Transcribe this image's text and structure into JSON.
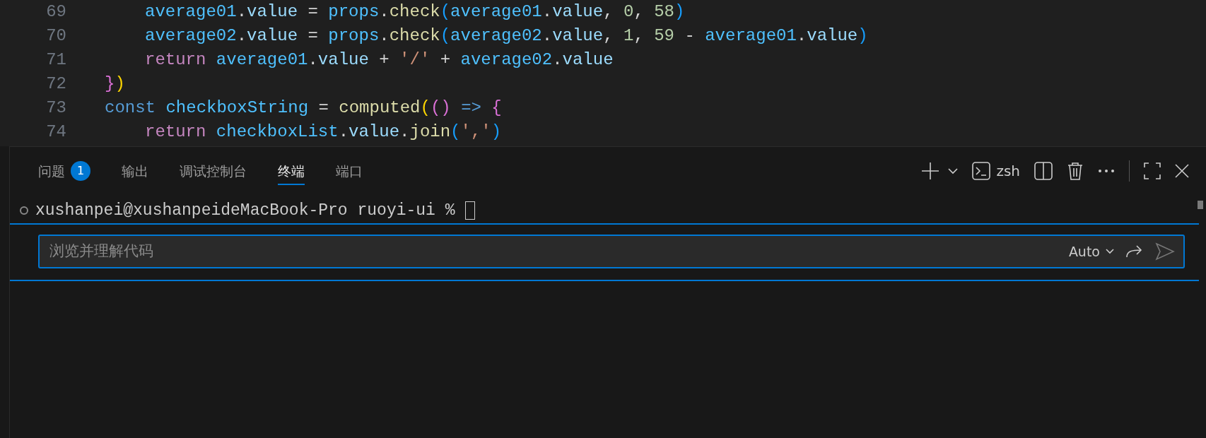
{
  "editor": {
    "lines": [
      {
        "number": "69",
        "indented": true,
        "tokens": [
          {
            "text": "average01",
            "kind": "const"
          },
          {
            "text": ".",
            "kind": "plain"
          },
          {
            "text": "value",
            "kind": "prop"
          },
          {
            "text": " = ",
            "kind": "plain"
          },
          {
            "text": "props",
            "kind": "const"
          },
          {
            "text": ".",
            "kind": "plain"
          },
          {
            "text": "check",
            "kind": "fn"
          },
          {
            "text": "(",
            "kind": "b3"
          },
          {
            "text": "average01",
            "kind": "const"
          },
          {
            "text": ".",
            "kind": "plain"
          },
          {
            "text": "value",
            "kind": "prop"
          },
          {
            "text": ", ",
            "kind": "plain"
          },
          {
            "text": "0",
            "kind": "num"
          },
          {
            "text": ", ",
            "kind": "plain"
          },
          {
            "text": "58",
            "kind": "num"
          },
          {
            "text": ")",
            "kind": "b3"
          }
        ]
      },
      {
        "number": "70",
        "indented": true,
        "tokens": [
          {
            "text": "average02",
            "kind": "const"
          },
          {
            "text": ".",
            "kind": "plain"
          },
          {
            "text": "value",
            "kind": "prop"
          },
          {
            "text": " = ",
            "kind": "plain"
          },
          {
            "text": "props",
            "kind": "const"
          },
          {
            "text": ".",
            "kind": "plain"
          },
          {
            "text": "check",
            "kind": "fn"
          },
          {
            "text": "(",
            "kind": "b3"
          },
          {
            "text": "average02",
            "kind": "const"
          },
          {
            "text": ".",
            "kind": "plain"
          },
          {
            "text": "value",
            "kind": "prop"
          },
          {
            "text": ", ",
            "kind": "plain"
          },
          {
            "text": "1",
            "kind": "num"
          },
          {
            "text": ", ",
            "kind": "plain"
          },
          {
            "text": "59",
            "kind": "num"
          },
          {
            "text": " - ",
            "kind": "plain"
          },
          {
            "text": "average01",
            "kind": "const"
          },
          {
            "text": ".",
            "kind": "plain"
          },
          {
            "text": "value",
            "kind": "prop"
          },
          {
            "text": ")",
            "kind": "b3"
          }
        ]
      },
      {
        "number": "71",
        "indented": true,
        "tokens": [
          {
            "text": "return ",
            "kind": "control"
          },
          {
            "text": "average01",
            "kind": "const"
          },
          {
            "text": ".",
            "kind": "plain"
          },
          {
            "text": "value",
            "kind": "prop"
          },
          {
            "text": " + ",
            "kind": "plain"
          },
          {
            "text": "'/'",
            "kind": "str"
          },
          {
            "text": " + ",
            "kind": "plain"
          },
          {
            "text": "average02",
            "kind": "const"
          },
          {
            "text": ".",
            "kind": "plain"
          },
          {
            "text": "value",
            "kind": "prop"
          }
        ]
      },
      {
        "number": "72",
        "indented": false,
        "tokens": [
          {
            "text": "}",
            "kind": "b2"
          },
          {
            "text": ")",
            "kind": "b1"
          }
        ]
      },
      {
        "number": "73",
        "indented": false,
        "tokens": [
          {
            "text": "const ",
            "kind": "keyword"
          },
          {
            "text": "checkboxString",
            "kind": "const"
          },
          {
            "text": " = ",
            "kind": "plain"
          },
          {
            "text": "computed",
            "kind": "fn"
          },
          {
            "text": "(",
            "kind": "b1"
          },
          {
            "text": "() ",
            "kind": "b2"
          },
          {
            "text": "=> ",
            "kind": "keyword"
          },
          {
            "text": "{",
            "kind": "b2"
          }
        ]
      },
      {
        "number": "74",
        "indented": true,
        "tokens": [
          {
            "text": "return ",
            "kind": "control"
          },
          {
            "text": "checkboxList",
            "kind": "const"
          },
          {
            "text": ".",
            "kind": "plain"
          },
          {
            "text": "value",
            "kind": "prop"
          },
          {
            "text": ".",
            "kind": "plain"
          },
          {
            "text": "join",
            "kind": "fn"
          },
          {
            "text": "(",
            "kind": "b3"
          },
          {
            "text": "','",
            "kind": "str"
          },
          {
            "text": ")",
            "kind": "b3"
          }
        ]
      }
    ]
  },
  "panel": {
    "tabs": [
      {
        "label": "问题",
        "badge": "1",
        "selected": false
      },
      {
        "label": "输出",
        "selected": false
      },
      {
        "label": "调试控制台",
        "selected": false
      },
      {
        "label": "终端",
        "selected": true
      },
      {
        "label": "端口",
        "selected": false
      }
    ],
    "shell": "zsh",
    "terminal": {
      "prompt": "xushanpei@xushanpeideMacBook-Pro ruoyi-ui %"
    },
    "chat": {
      "placeholder": "浏览并理解代码",
      "mode": "Auto"
    }
  }
}
